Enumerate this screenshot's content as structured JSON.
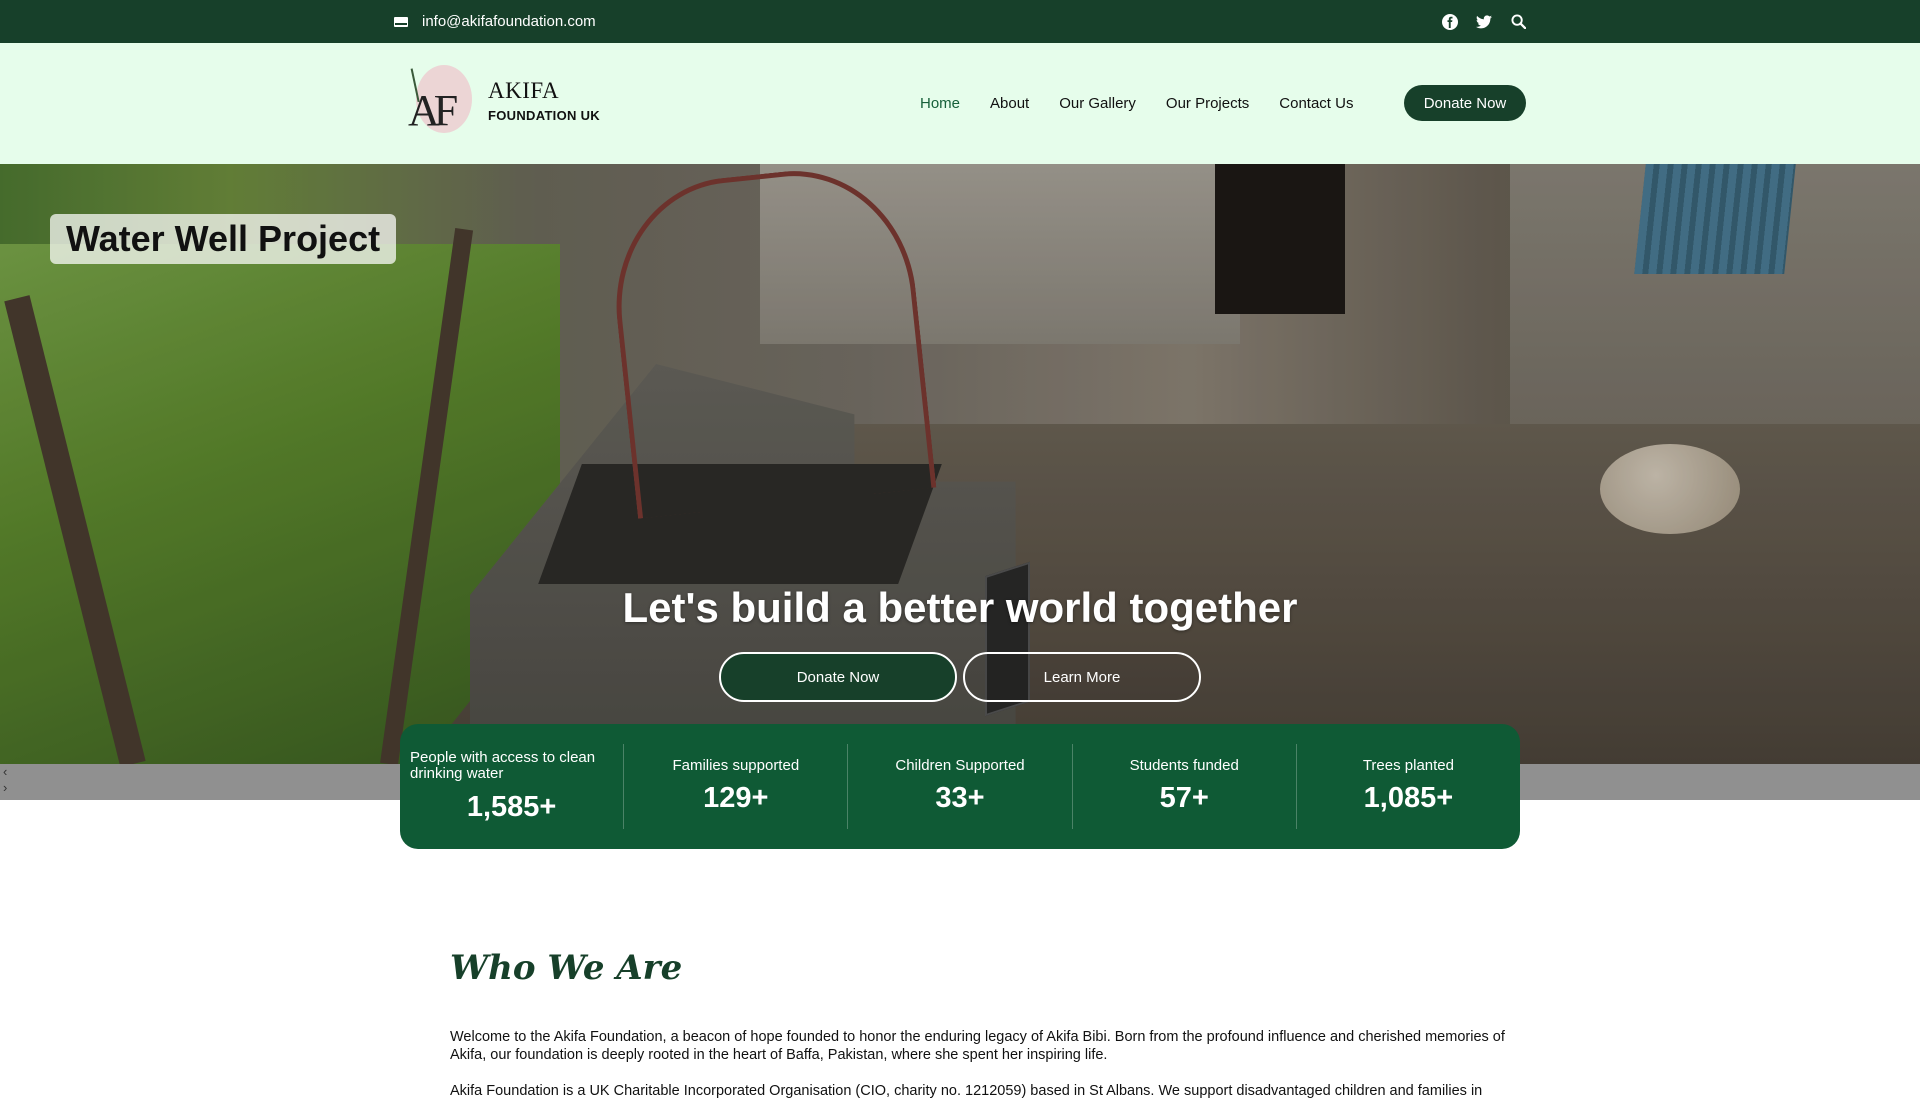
{
  "topbar": {
    "email": "info@akifafoundation.com",
    "icons": [
      "envelope-icon",
      "facebook-icon",
      "twitter-icon",
      "search-icon"
    ]
  },
  "header": {
    "logo_line1": "AKIFA",
    "logo_line2": "FOUNDATION UK",
    "logo_mark": "AF",
    "nav": [
      {
        "label": "Home",
        "active": true
      },
      {
        "label": "About",
        "active": false
      },
      {
        "label": "Our Gallery",
        "active": false
      },
      {
        "label": "Our Projects",
        "active": false
      },
      {
        "label": "Contact Us",
        "active": false
      }
    ],
    "donate_label": "Donate Now"
  },
  "hero": {
    "project_title": "Water Well Project",
    "heading": "Let's build a better world together",
    "donate_label": "Donate Now",
    "learn_label": "Learn More"
  },
  "stats": [
    {
      "label": "People with access to clean drinking water",
      "value": "1,585+"
    },
    {
      "label": "Families supported",
      "value": "129+"
    },
    {
      "label": "Children Supported",
      "value": "33+"
    },
    {
      "label": "Students funded",
      "value": "57+"
    },
    {
      "label": "Trees planted",
      "value": "1,085+"
    }
  ],
  "who": {
    "title": "Who We Are",
    "p1": "Welcome to the Akifa Foundation, a beacon of hope founded to honor the enduring legacy of Akifa Bibi. Born from the profound influence and cherished memories of Akifa, our foundation is deeply rooted in the heart of Baffa, Pakistan, where she spent her inspiring life.",
    "p2": "Akifa Foundation is a UK Charitable Incorporated Organisation (CIO, charity no. 1212059) based in St Albans. We support disadvantaged children and families in"
  },
  "colors": {
    "topbar": "#17402a",
    "header_bg": "#e6fdeb",
    "accent": "#17603a",
    "stats_bg": "#0f5a35"
  }
}
